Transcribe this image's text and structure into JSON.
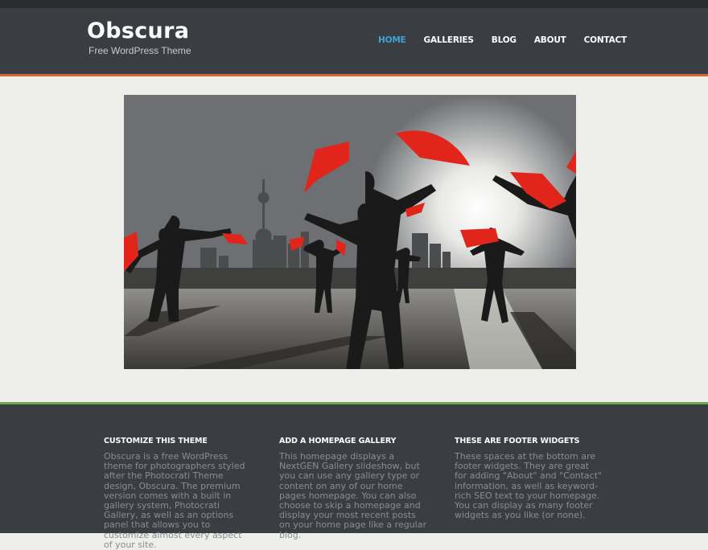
{
  "site": {
    "title": "Obscura",
    "tagline": "Free WordPress Theme"
  },
  "nav": {
    "items": [
      {
        "label": "HOME",
        "active": true
      },
      {
        "label": "GALLERIES",
        "active": false
      },
      {
        "label": "BLOG",
        "active": false
      },
      {
        "label": "ABOUT",
        "active": false
      },
      {
        "label": "CONTACT",
        "active": false
      }
    ],
    "active_color": "#3fa3d8"
  },
  "hero": {
    "image": "photo-fan-dancers-skyline"
  },
  "footer": {
    "widgets": [
      {
        "title": "CUSTOMIZE THIS THEME",
        "body": "Obscura is a free WordPress theme for photographers styled after the Photocrati Theme design, Obscura. The premium version comes with a built in gallery system, Photocrati Gallery, as well as an options panel that allows you to customize almost every aspect of your site."
      },
      {
        "title": "ADD A HOMEPAGE GALLERY",
        "body": "This homepage displays a NextGEN Gallery slideshow, but you can use any gallery type or content on any of our home pages homepage. You can also choose to skip a homepage and display your most recent posts on your home page like a regular blog."
      },
      {
        "title": "THESE ARE FOOTER WIDGETS",
        "body": "These spaces at the bottom are footer widgets. They are great for adding \"About\" and \"Contact\" information, as well as keyword-rich SEO text to your homepage. You can display as many footer widgets as you like (or none)."
      }
    ]
  },
  "colors": {
    "header_bg": "#3a3d42",
    "header_accent": "#d9612a",
    "footer_accent": "#6aa84f",
    "page_bg": "#eeeeea"
  }
}
